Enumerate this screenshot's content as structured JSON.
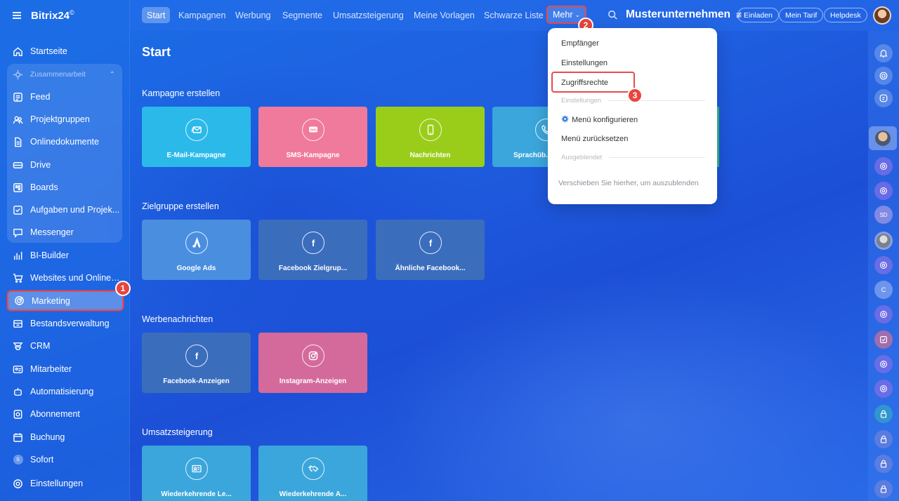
{
  "sidebar": {
    "logo": "Bitrix24",
    "logo_mark": "©",
    "items": [
      {
        "label": "Startseite",
        "icon": "home-icon"
      },
      {
        "label": "Zusammenarbeit",
        "icon": "collaboration-icon"
      },
      {
        "label": "Feed",
        "icon": "feed-icon"
      },
      {
        "label": "Projektgruppen",
        "icon": "groups-icon"
      },
      {
        "label": "Onlinedokumente",
        "icon": "document-icon"
      },
      {
        "label": "Drive",
        "icon": "drive-icon"
      },
      {
        "label": "Boards",
        "icon": "boards-icon"
      },
      {
        "label": "Aufgaben und Projek...",
        "icon": "tasks-icon"
      },
      {
        "label": "Messenger",
        "icon": "messenger-icon"
      },
      {
        "label": "BI-Builder",
        "icon": "bi-builder-icon"
      },
      {
        "label": "Websites und Onlines...",
        "icon": "shop-cart-icon"
      },
      {
        "label": "Marketing",
        "icon": "marketing-target-icon"
      },
      {
        "label": "Bestandsverwaltung",
        "icon": "inventory-icon"
      },
      {
        "label": "CRM",
        "icon": "crm-icon"
      },
      {
        "label": "Mitarbeiter",
        "icon": "employees-icon"
      },
      {
        "label": "Automatisierung",
        "icon": "automation-icon"
      },
      {
        "label": "Abonnement",
        "icon": "subscription-icon"
      },
      {
        "label": "Buchung",
        "icon": "booking-icon"
      },
      {
        "label": "Sofort",
        "icon": "sofort-icon"
      },
      {
        "label": "Einstellungen",
        "icon": "settings-icon"
      }
    ],
    "sofort_initial": "S",
    "step_badge": "1"
  },
  "topbar": {
    "tabs": [
      "Start",
      "Kampagnen",
      "Werbung",
      "Segmente",
      "Umsatzsteigerung",
      "Meine Vorlagen",
      "Schwarze Liste",
      "Mehr"
    ],
    "mehr_chevron": "⌄",
    "step_badge": "2",
    "company": "Musterunternehmen",
    "company_icon": "≇",
    "buttons": [
      "Einladen",
      "Mein Tarif",
      "Helpdesk"
    ]
  },
  "main": {
    "title": "Start",
    "sections": [
      {
        "title": "Kampagne erstellen",
        "tiles": [
          {
            "label": "E-Mail-Kampagne",
            "icon": "email-icon",
            "color": "#2bb9ea"
          },
          {
            "label": "SMS-Kampagne",
            "icon": "sms-icon",
            "color": "#f07a9b"
          },
          {
            "label": "Nachrichten",
            "icon": "phone-icon",
            "color": "#9acd1a"
          },
          {
            "label": "Sprachüb...",
            "icon": "call-icon",
            "color": "#3ba6dc"
          }
        ]
      },
      {
        "title": "Zielgruppe erstellen",
        "tiles": [
          {
            "label": "Google Ads",
            "icon": "google-ads-icon",
            "color": "#4a8ee0"
          },
          {
            "label": "Facebook Zielgrup...",
            "icon": "facebook-icon",
            "color": "#3b6dbd"
          },
          {
            "label": "Ähnliche Facebook...",
            "icon": "facebook-icon",
            "color": "#3b6dbd"
          }
        ]
      },
      {
        "title": "Werbenachrichten",
        "tiles": [
          {
            "label": "Facebook-Anzeigen",
            "icon": "facebook-icon",
            "color": "#3b6dbd"
          },
          {
            "label": "Instagram-Anzeigen",
            "icon": "instagram-icon",
            "color": "#d46a9c"
          }
        ]
      },
      {
        "title": "Umsatzsteigerung",
        "tiles": [
          {
            "label": "Wiederkehrende Le...",
            "icon": "repeat-lead-icon",
            "color": "#3ba6dc"
          },
          {
            "label": "Wiederkehrende A...",
            "icon": "handshake-icon",
            "color": "#3ba6dc"
          }
        ]
      }
    ]
  },
  "dropdown": {
    "items": [
      "Empfänger",
      "Einstellungen",
      "Zugriffsrechte"
    ],
    "separator1": "Einstellungen",
    "configure": "Menü konfigurieren",
    "reset": "Menü zurücksetzen",
    "separator2": "Ausgeblendet",
    "hint": "Verschieben Sie hierher, um auszublenden",
    "step_badge": "3"
  },
  "rail": {
    "initials_sd": "SD",
    "initials_c": "C"
  },
  "colors": {
    "highlight_red": "#e64c4c",
    "badge_red": "#e8453c"
  }
}
